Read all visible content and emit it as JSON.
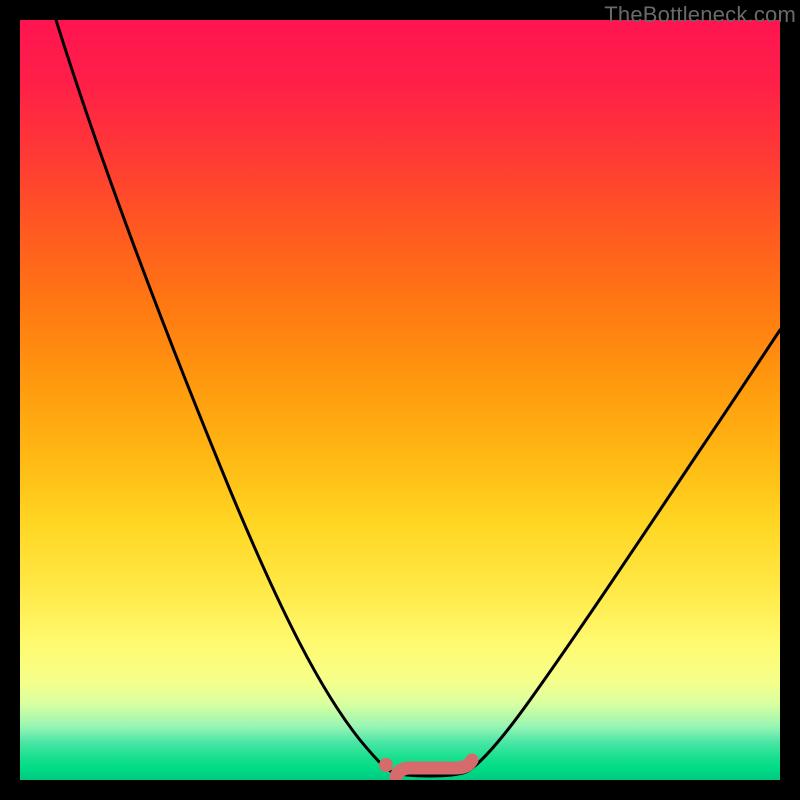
{
  "watermark": {
    "text": "TheBottleneck.com"
  },
  "colors": {
    "page_bg": "#000000",
    "curve_stroke": "#000000",
    "marker_fill": "#d76b6b",
    "marker_stroke": "#cf5a5a"
  },
  "chart_data": {
    "type": "line",
    "title": "",
    "xlabel": "",
    "ylabel": "",
    "xlim": [
      0,
      100
    ],
    "ylim": [
      0,
      100
    ],
    "grid": false,
    "legend": false,
    "series": [
      {
        "name": "bottleneck-curve",
        "x": [
          5,
          10,
          15,
          20,
          25,
          30,
          35,
          40,
          44,
          48,
          50,
          52,
          54,
          56,
          58,
          62,
          68,
          74,
          80,
          86,
          92,
          98
        ],
        "y": [
          100,
          84,
          70,
          56,
          44,
          32,
          22,
          13,
          6,
          2,
          1,
          0.5,
          0.5,
          0.5,
          1,
          4,
          11,
          20,
          30,
          41,
          53,
          66
        ]
      }
    ],
    "markers": [
      {
        "name": "flat-basin-dot",
        "x": 48.5,
        "y": 2
      },
      {
        "name": "flat-basin-segment",
        "x_from": 50,
        "x_to": 58,
        "y": 0.8
      }
    ]
  }
}
